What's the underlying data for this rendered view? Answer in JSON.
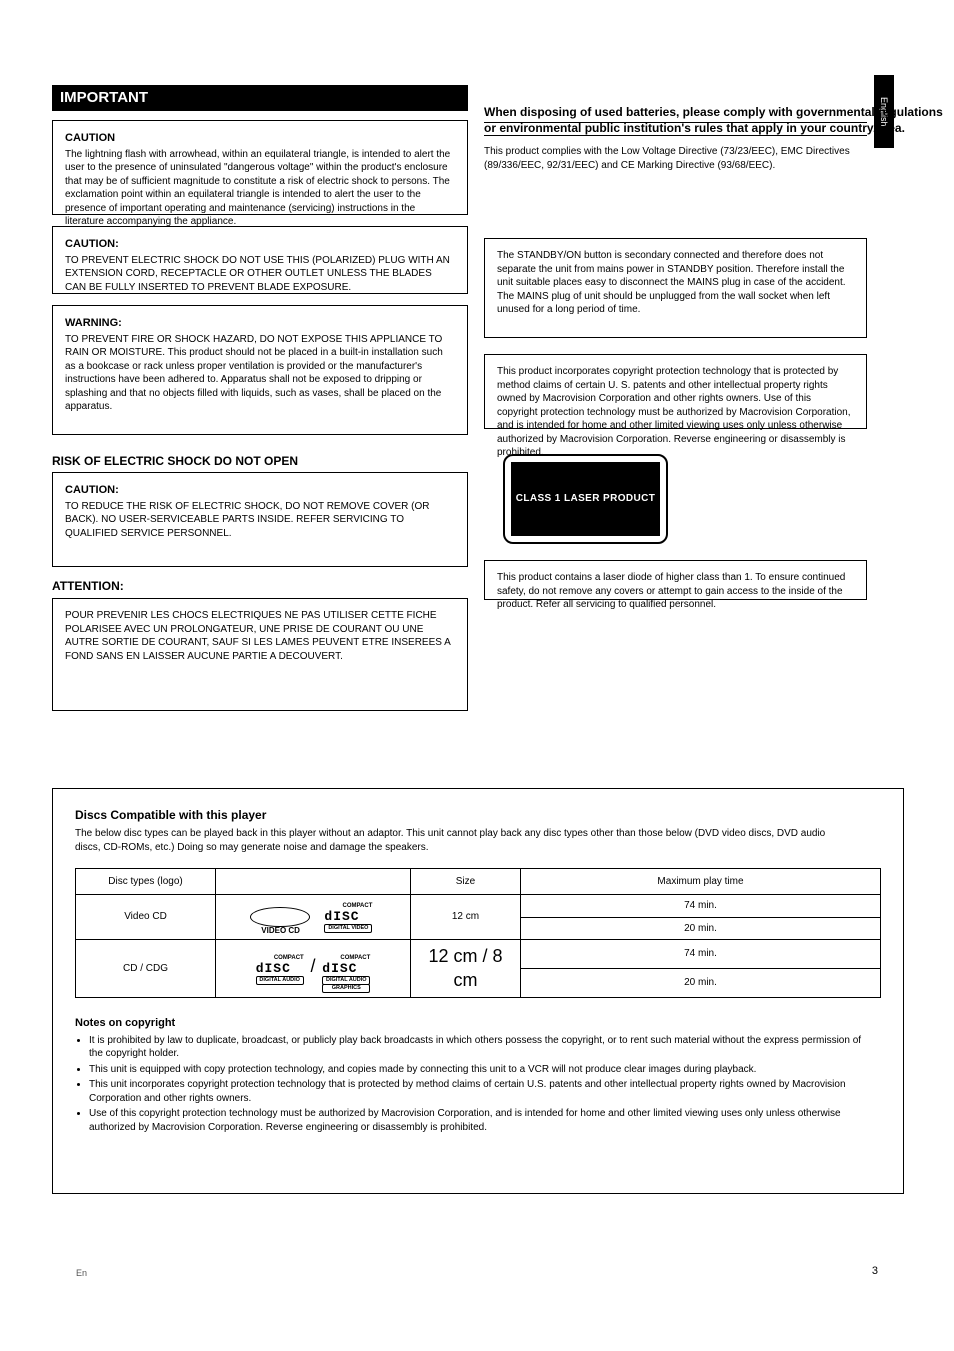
{
  "header_bar": "IMPORTANT",
  "side_tab": "English",
  "right_col": {
    "title": "When disposing of used batteries, please comply with governmental regulations or environmental public institution's rules that apply in your country/area.",
    "intro": "This product complies with the Low Voltage Directive (73/23/EEC), EMC Directives (89/336/EEC, 92/31/EEC) and CE Marking Directive (93/68/EEC).",
    "r_box1": "The STANDBY/ON button is secondary connected and therefore does not separate the unit from mains power in STANDBY position. Therefore install the unit suitable places easy to disconnect the MAINS plug in case of the accident. The MAINS plug of unit should be unplugged from the wall socket when left unused for a long period of time.",
    "r_box2": "This product incorporates copyright protection technology that is protected by method claims of certain U. S. patents and other intellectual property rights owned by Macrovision Corporation and other rights owners. Use of this copyright protection technology must be authorized by Macrovision Corporation, and is intended for home and other limited viewing uses only unless otherwise authorized by Macrovision Corporation. Reverse engineering or disassembly is prohibited.",
    "laser_label": "CLASS 1 LASER PRODUCT",
    "r_box3": "This product contains a laser diode of higher class than 1. To ensure continued safety, do not remove any covers or attempt to gain access to the inside of the product. Refer all servicing to qualified personnel."
  },
  "left_col": {
    "l1": {
      "title": "CAUTION",
      "body": "The lightning flash with arrowhead, within an equilateral triangle, is intended to alert the user to the presence of uninsulated \"dangerous voltage\" within the product's enclosure that may be of sufficient magnitude to constitute a risk of electric shock to persons. The exclamation point within an equilateral triangle is intended to alert the user to the presence of important operating and maintenance (servicing) instructions in the literature accompanying the appliance."
    },
    "l2": {
      "title": "CAUTION:",
      "body": "TO PREVENT ELECTRIC SHOCK DO NOT USE THIS (POLARIZED) PLUG WITH AN EXTENSION CORD, RECEPTACLE OR OTHER OUTLET UNLESS THE BLADES CAN BE FULLY INSERTED TO PREVENT BLADE EXPOSURE."
    },
    "l3": {
      "title": "WARNING:",
      "body": "TO PREVENT FIRE OR SHOCK HAZARD, DO NOT EXPOSE THIS APPLIANCE TO RAIN OR MOISTURE. This product should not be placed in a built-in installation such as a bookcase or rack unless proper ventilation is provided or the manufacturer's instructions have been adhered to. Apparatus shall not be exposed to dripping or splashing and that no objects filled with liquids, such as vases, shall be placed on the apparatus."
    },
    "section_l4_title": "RISK OF ELECTRIC SHOCK DO NOT OPEN",
    "l4": {
      "title": "CAUTION:",
      "body": "TO REDUCE THE RISK OF ELECTRIC SHOCK, DO NOT REMOVE COVER (OR BACK). NO USER-SERVICEABLE PARTS INSIDE. REFER SERVICING TO QUALIFIED SERVICE PERSONNEL."
    },
    "section_l5_title": "ATTENTION:",
    "l5": {
      "body": "POUR PREVENIR LES CHOCS ELECTRIQUES NE PAS UTILISER CETTE FICHE POLARISEE AVEC UN PROLONGATEUR, UNE PRISE DE COURANT OU UNE AUTRE SORTIE DE COURANT, SAUF SI LES LAMES PEUVENT ETRE INSEREES A FOND SANS EN LAISSER AUCUNE PARTIE A DECOUVERT."
    }
  },
  "big_box": {
    "title": "Discs Compatible with this player",
    "desc": "The below disc types can be played back in this player without an adaptor. This unit cannot play back any disc types other than those below (DVD video discs, DVD audio discs, CD-ROMs, etc.) Doing so may generate noise and damage the speakers.",
    "table": {
      "headers": [
        "Disc types (logo)",
        "",
        "Size",
        "Maximum play time",
        ""
      ],
      "rows": [
        {
          "type": "Video CD",
          "logo_label": "VIDEO CD",
          "sub1": "DIGITAL VIDEO",
          "size": "12 cm",
          "r1": "74 min.",
          "r2": "20 min."
        },
        {
          "type": "CD / CDG",
          "logo_sub_a": "DIGITAL AUDIO",
          "logo_sub_b1": "DIGITAL AUDIO",
          "logo_sub_b2": "GRAPHICS",
          "size": "12 cm / 8 cm",
          "r1": "74 min.",
          "r2": "20 min."
        }
      ]
    },
    "note_title": "Notes on copyright",
    "notes": [
      "It is prohibited by law to duplicate, broadcast, or publicly play back broadcasts in which others possess the copyright, or to rent such material without the express permission of the copyright holder.",
      "This unit is equipped with copy protection technology, and copies made by connecting this unit to a VCR will not produce clear images during playback.",
      "This unit incorporates copyright protection technology that is protected by method claims of certain U.S. patents and other intellectual property rights owned by Macrovision Corporation and other rights owners.",
      "Use of this copyright protection technology must be authorized by Macrovision Corporation, and is intended for home and other limited viewing uses only unless otherwise authorized by Macrovision Corporation. Reverse engineering or disassembly is prohibited."
    ]
  },
  "page_number": "3",
  "footer_code": "En"
}
